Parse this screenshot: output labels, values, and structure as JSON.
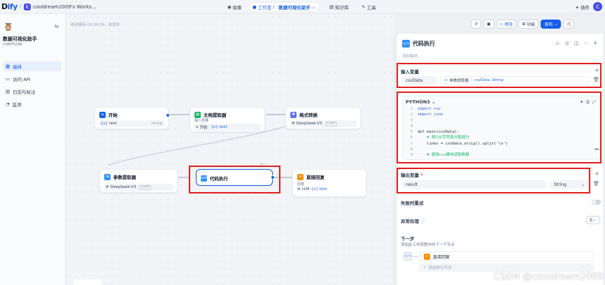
{
  "topbar": {
    "logo_main": "D",
    "logo_accent": "ify",
    "workspace_badge": "C",
    "workspace_name": "cooldream2009's Works...",
    "nav": {
      "explore": "探索",
      "studio": "工作室",
      "app_name": "数据可视化助手",
      "knowledge": "知识库",
      "tools": "工具"
    },
    "plugins": "插件",
    "avatar": "C"
  },
  "sidebar": {
    "app_name": "数据可视化助手",
    "app_type": "CHATFLOW",
    "items": [
      {
        "label": "编排"
      },
      {
        "label": "访问 API"
      },
      {
        "label": "日志与标注"
      },
      {
        "label": "监测"
      }
    ]
  },
  "canvas": {
    "autosave": "自动保存 03:10:54 · 未发布",
    "nodes": {
      "start": {
        "title": "开始",
        "var": "text",
        "var_type": "string"
      },
      "doc_extract": {
        "title": "文档提取器",
        "label": "输入变量",
        "src": "开始",
        "var": "text"
      },
      "format": {
        "title": "格式转换",
        "model": "DeepSeek-V3",
        "mode": "CHAT"
      },
      "param_extract": {
        "title": "参数提取器",
        "model": "DeepSeek-V3",
        "mode": "CHAT"
      },
      "code": {
        "title": "代码执行"
      },
      "reply": {
        "title": "直接回复",
        "label": "回复",
        "src": "LLM",
        "var": "text"
      }
    }
  },
  "toolbar": {
    "preview": "预览",
    "features": "功能",
    "publish": "发布"
  },
  "panel": {
    "title": "代码执行",
    "desc_placeholder": "添加描述...",
    "input_section": "输入变量",
    "input_name": "csvData",
    "input_src_node": "参数提取器",
    "input_src_var": "csvData",
    "input_src_type": "String",
    "lang": "PYTHON3",
    "code_lines": [
      "import csv",
      "import json",
      "",
      "",
      "def main(csvData):",
      "    # 将CSV字符串分割成行",
      "    lines = csvData.strip().split('\\n')",
      "",
      "    # 使用csv模块读取数据"
    ],
    "output_section": "输出变量",
    "output_required": "*",
    "output_name": "result",
    "output_type": "String",
    "retry": "失败时重试",
    "exception": "异常处理",
    "exception_value": "无",
    "next_title": "下一步",
    "next_desc": "添加此工作流程中的下一个节点",
    "next_node": "直接回复",
    "add_node": "添加并行节点"
  },
  "watermark": "CSDN @cooldream2009"
}
